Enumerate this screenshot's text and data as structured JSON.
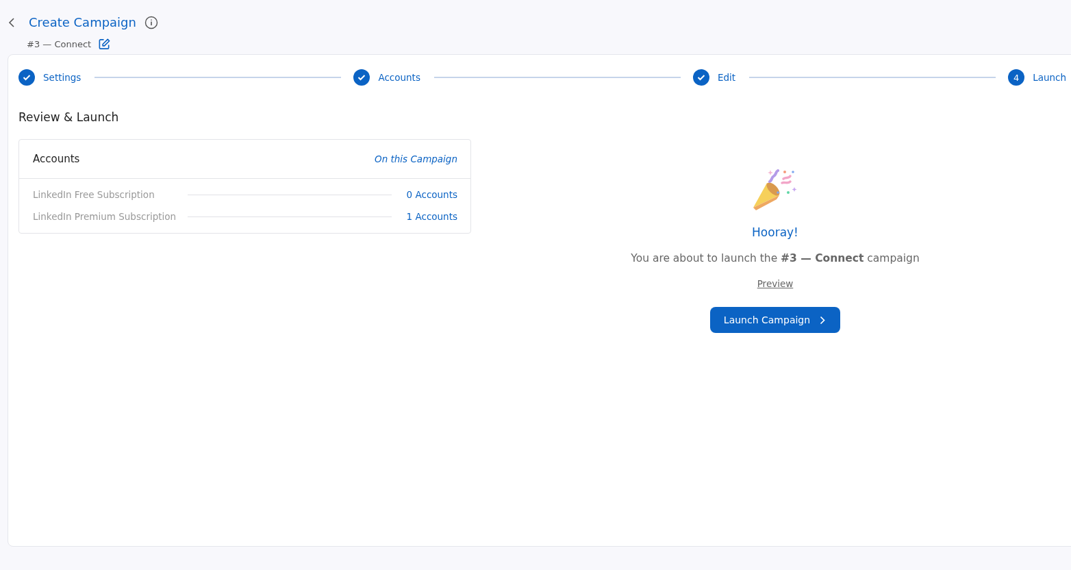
{
  "header": {
    "title": "Create Campaign",
    "campaign_name": "#3 — Connect"
  },
  "steps": [
    {
      "label": "Settings",
      "kind": "done"
    },
    {
      "label": "Accounts",
      "kind": "done"
    },
    {
      "label": "Edit",
      "kind": "done"
    },
    {
      "label": "Launch",
      "kind": "current",
      "number": "4"
    }
  ],
  "section_title": "Review & Launch",
  "accounts_card": {
    "title": "Accounts",
    "subtitle": "On this Campaign",
    "rows": [
      {
        "label": "LinkedIn Free Subscription",
        "value": "0 Accounts"
      },
      {
        "label": "LinkedIn Premium Subscription",
        "value": "1 Accounts"
      }
    ]
  },
  "launch_panel": {
    "heading": "Hooray!",
    "message": "You are about to launch the **#3 — Connect** campaign",
    "preview_link": "Preview",
    "button": "Launch Campaign"
  }
}
